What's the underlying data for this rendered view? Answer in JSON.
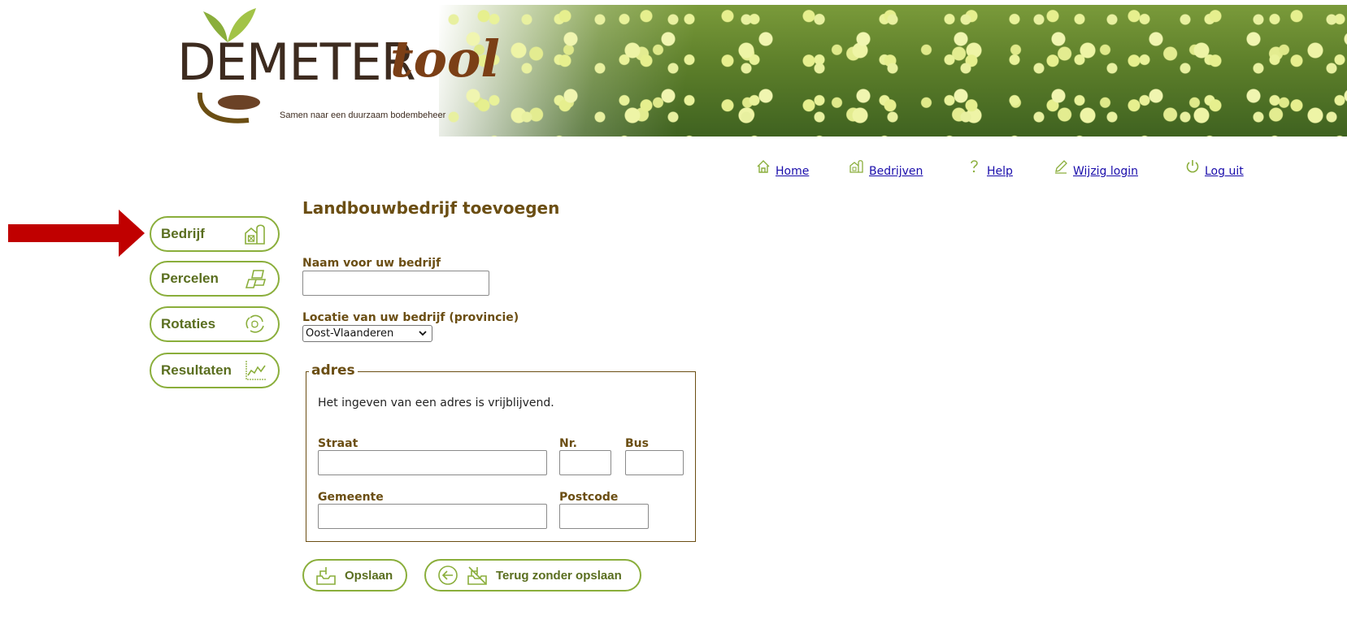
{
  "header": {
    "logo_main": "DEMETER",
    "logo_accent": "tool",
    "tagline": "Samen naar een duurzaam bodembeheer"
  },
  "topnav": [
    {
      "label": "Home",
      "icon": "house-icon"
    },
    {
      "label": "Bedrijven",
      "icon": "farm-icon"
    },
    {
      "label": "Help",
      "icon": "question-icon"
    },
    {
      "label": "Wijzig login",
      "icon": "pencil-icon"
    },
    {
      "label": "Log uit",
      "icon": "power-icon"
    }
  ],
  "sidebar": [
    {
      "label": "Bedrijf",
      "icon": "farm-icon"
    },
    {
      "label": "Percelen",
      "icon": "parcels-icon"
    },
    {
      "label": "Rotaties",
      "icon": "rotation-icon"
    },
    {
      "label": "Resultaten",
      "icon": "chart-icon"
    }
  ],
  "form": {
    "title": "Landbouwbedrijf toevoegen",
    "name_label": "Naam voor uw bedrijf",
    "name_value": "",
    "province_label": "Locatie van uw bedrijf (provincie)",
    "province_value": "Oost-Vlaanderen",
    "address": {
      "legend": "adres",
      "info": "Het ingeven van een adres is vrijblijvend.",
      "street_label": "Straat",
      "nr_label": "Nr.",
      "bus_label": "Bus",
      "municipality_label": "Gemeente",
      "postcode_label": "Postcode"
    }
  },
  "buttons": {
    "save": "Opslaan",
    "back": "Terug zonder opslaan"
  },
  "colors": {
    "accent_green": "#8aae3b",
    "label_brown": "#6b4e13",
    "arrow_red": "#c00000",
    "link_blue": "#1a0dab"
  }
}
